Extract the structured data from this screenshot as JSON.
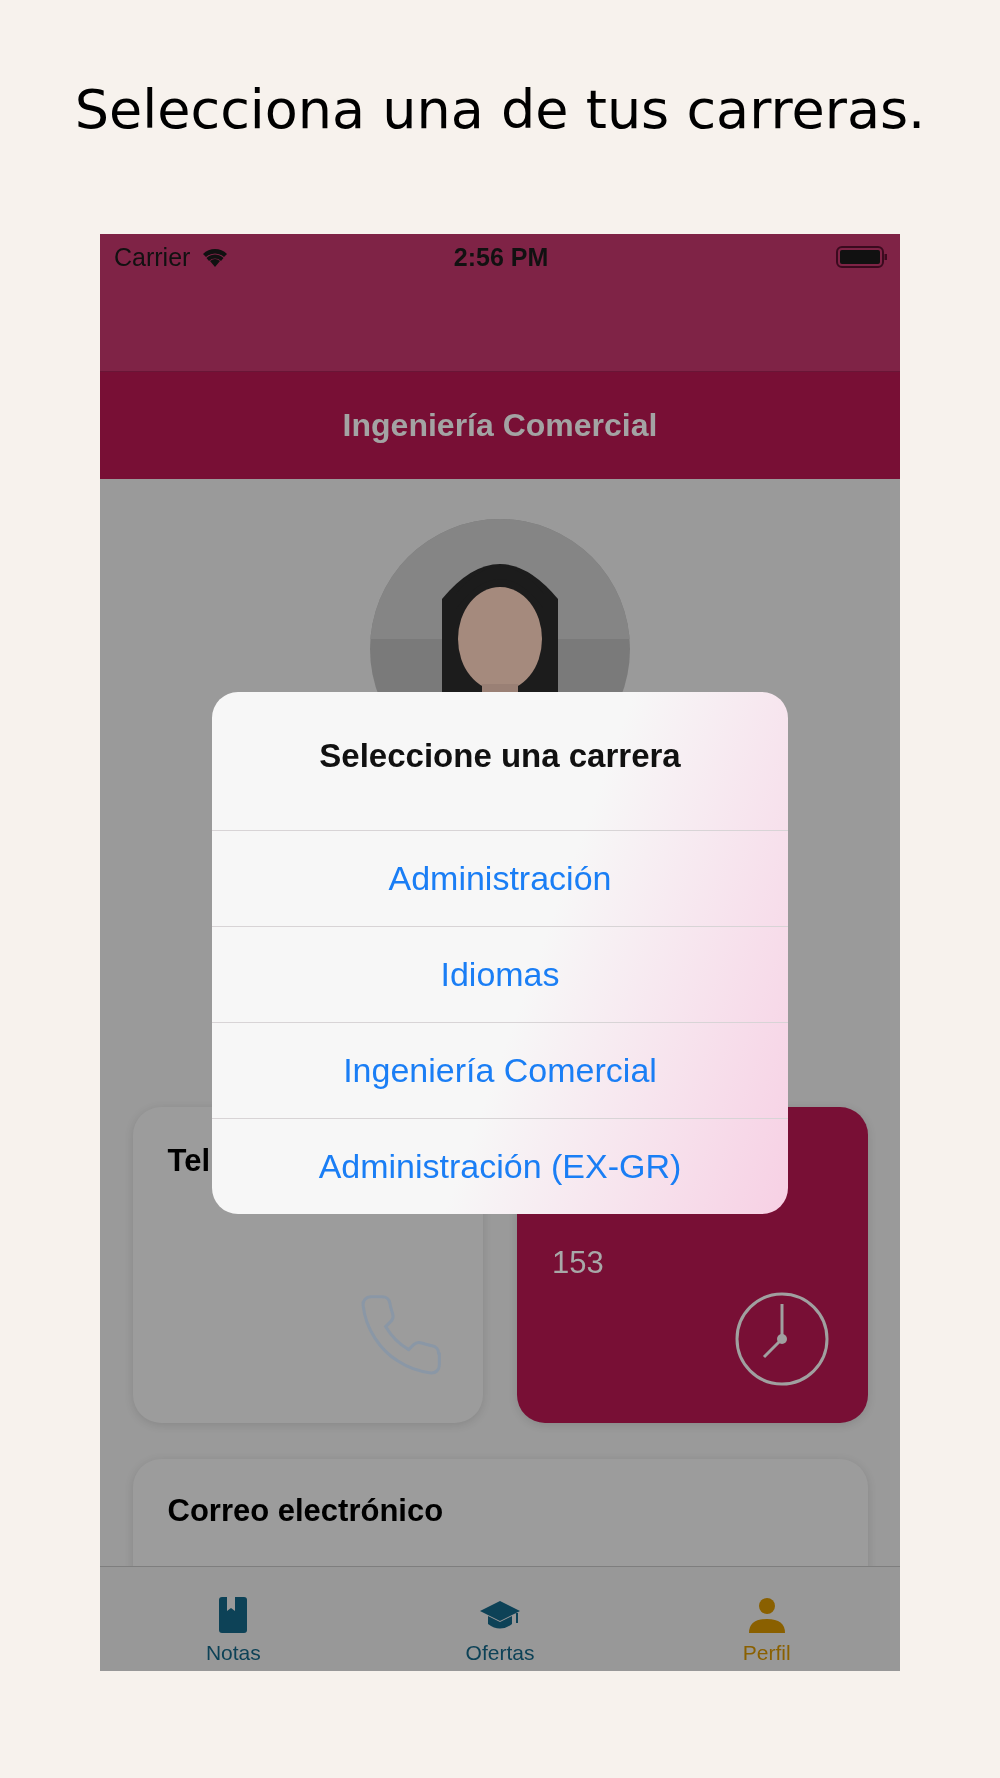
{
  "heading": "Selecciona una de tus carreras.",
  "status_bar": {
    "carrier": "Carrier",
    "time": "2:56 PM"
  },
  "nav_bar": {
    "title": "Ingeniería Comercial"
  },
  "cards": [
    {
      "kind": "phone",
      "title": "Tel"
    },
    {
      "kind": "service",
      "value": "153"
    }
  ],
  "email_card": {
    "title": "Correo electrónico"
  },
  "dialog": {
    "title": "Seleccione una carrera",
    "options": [
      "Administración",
      "Idiomas",
      "Ingeniería Comercial",
      "Administración (EX-GR)"
    ]
  },
  "tab_bar": [
    {
      "label": "Notas",
      "kind": "book",
      "selected": false
    },
    {
      "label": "Ofertas",
      "kind": "cap",
      "selected": false
    },
    {
      "label": "Perfil",
      "kind": "person",
      "selected": true
    }
  ]
}
